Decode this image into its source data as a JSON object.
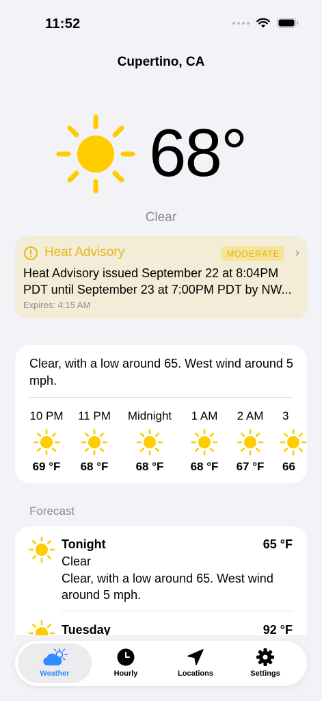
{
  "status_bar": {
    "time": "11:52"
  },
  "location": {
    "city": "Cupertino, CA"
  },
  "current": {
    "temperature": "68°",
    "condition": "Clear"
  },
  "advisory": {
    "title": "Heat Advisory",
    "severity": "MODERATE",
    "body": "Heat Advisory issued September 22 at 8:04PM PDT until September 23 at 7:00PM PDT by NW...",
    "expires": "Expires: 4:15 AM"
  },
  "hourly_card": {
    "summary": "Clear, with a low around 65. West wind around 5 mph.",
    "hours": [
      {
        "label": "10 PM",
        "temp": "69 °F",
        "icon": "sun-icon"
      },
      {
        "label": "11 PM",
        "temp": "68 °F",
        "icon": "sun-icon"
      },
      {
        "label": "Midnight",
        "temp": "68 °F",
        "icon": "sun-icon"
      },
      {
        "label": "1 AM",
        "temp": "68 °F",
        "icon": "sun-icon"
      },
      {
        "label": "2 AM",
        "temp": "67 °F",
        "icon": "sun-icon"
      },
      {
        "label": "3",
        "temp": "66",
        "icon": "sun-icon"
      }
    ]
  },
  "forecast": {
    "label": "Forecast",
    "periods": [
      {
        "name": "Tonight",
        "temp": "65 °F",
        "condition": "Clear",
        "description": "Clear, with a low around 65. West wind around 5 mph."
      },
      {
        "name": "Tuesday",
        "temp": "92 °F"
      }
    ]
  },
  "tabs": [
    {
      "label": "Weather",
      "icon": "cloud-sun-icon",
      "active": true
    },
    {
      "label": "Hourly",
      "icon": "clock-icon",
      "active": false
    },
    {
      "label": "Locations",
      "icon": "location-arrow-icon",
      "active": false
    },
    {
      "label": "Settings",
      "icon": "gear-icon",
      "active": false
    }
  ],
  "colors": {
    "sun": "#ffcc00",
    "advisory_bg": "#f3ecd6",
    "advisory_accent": "#e8b81a",
    "tab_active": "#2f8bff"
  }
}
